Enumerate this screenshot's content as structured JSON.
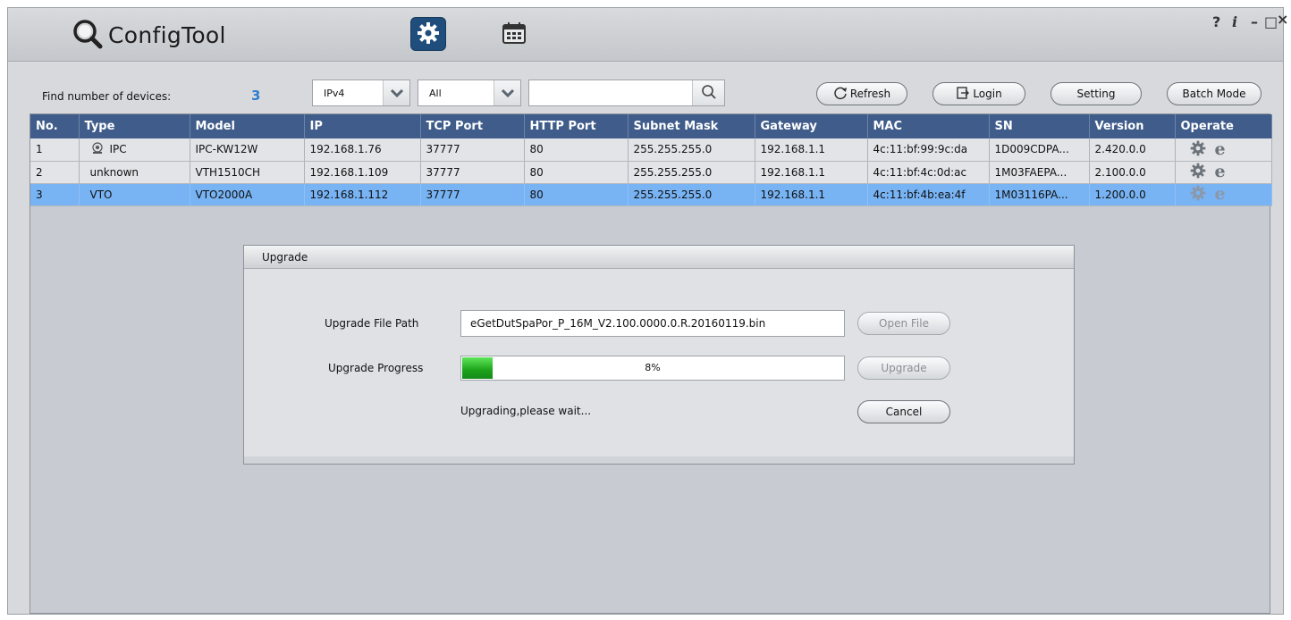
{
  "app": {
    "title": "ConfigTool",
    "window_controls": [
      "?",
      "i",
      "–",
      "□",
      "×"
    ]
  },
  "toolbar": {
    "find_label": "Find number of devices:",
    "find_count": "3",
    "ip_filter": "IPv4",
    "type_filter": "All",
    "search_value": "",
    "refresh_label": "Refresh",
    "login_label": "Login",
    "setting_label": "Setting",
    "batch_label": "Batch Mode"
  },
  "table": {
    "columns": [
      "No.",
      "Type",
      "Model",
      "IP",
      "TCP Port",
      "HTTP Port",
      "Subnet Mask",
      "Gateway",
      "MAC",
      "SN",
      "Version",
      "Operate"
    ],
    "rows": [
      {
        "no": "1",
        "type": "IPC",
        "model": "IPC-KW12W",
        "ip": "192.168.1.76",
        "tcp": "37777",
        "http": "80",
        "mask": "255.255.255.0",
        "gateway": "192.168.1.1",
        "mac": "4c:11:bf:99:9c:da",
        "sn": "1D009CDPA...",
        "version": "2.420.0.0",
        "has_icon": true
      },
      {
        "no": "2",
        "type": "unknown",
        "model": "VTH1510CH",
        "ip": "192.168.1.109",
        "tcp": "37777",
        "http": "80",
        "mask": "255.255.255.0",
        "gateway": "192.168.1.1",
        "mac": "4c:11:bf:4c:0d:ac",
        "sn": "1M03FAEPA...",
        "version": "2.100.0.0",
        "has_icon": false
      },
      {
        "no": "3",
        "type": "VTO",
        "model": "VTO2000A",
        "ip": "192.168.1.112",
        "tcp": "37777",
        "http": "80",
        "mask": "255.255.255.0",
        "gateway": "192.168.1.1",
        "mac": "4c:11:bf:4b:ea:4f",
        "sn": "1M03116PA...",
        "version": "1.200.0.0",
        "has_icon": false
      }
    ],
    "selected_row": 2
  },
  "dialog": {
    "title": "Upgrade",
    "file_path_label": "Upgrade File Path",
    "file_path_value": "eGetDutSpaPor_P_16M_V2.100.0000.0.R.20160119.bin",
    "open_file_label": "Open File",
    "progress_label": "Upgrade Progress",
    "progress_percent": 8,
    "progress_text": "8%",
    "upgrade_label": "Upgrade",
    "status_text": "Upgrading,please wait...",
    "cancel_label": "Cancel"
  },
  "colors": {
    "header_bg": "#3f5c8a",
    "selected_row": "#78b3f3",
    "count_blue": "#2f7fd0",
    "progress_green": "#1ca31a",
    "active_tab": "#1f4e7d"
  },
  "icons": [
    "search-icon",
    "gear-icon",
    "calendar-icon",
    "chevron-down-icon",
    "refresh-icon",
    "login-icon",
    "camera-icon",
    "ie-icon"
  ]
}
